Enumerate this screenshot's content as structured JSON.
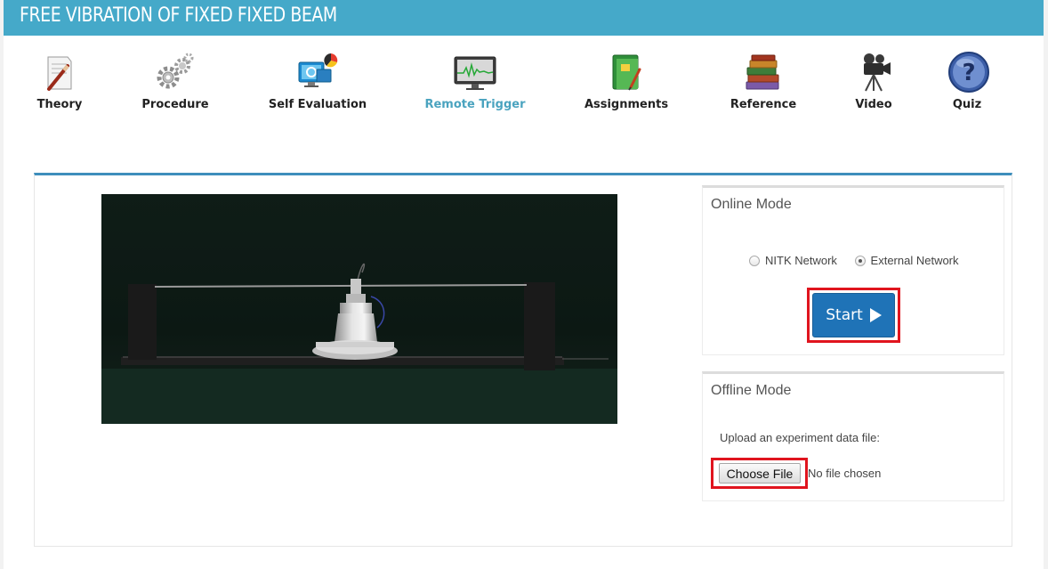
{
  "header": {
    "title": "FREE VIBRATION OF FIXED FIXED BEAM"
  },
  "nav": {
    "items": [
      {
        "label": "Theory",
        "icon": "pencil-document-icon"
      },
      {
        "label": "Procedure",
        "icon": "gears-icon"
      },
      {
        "label": "Self Evaluation",
        "icon": "monitor-pie-chart-icon"
      },
      {
        "label": "Remote Trigger",
        "icon": "signal-monitor-icon",
        "active": true
      },
      {
        "label": "Assignments",
        "icon": "notebook-icon"
      },
      {
        "label": "Reference",
        "icon": "books-icon"
      },
      {
        "label": "Video",
        "icon": "movie-camera-icon"
      },
      {
        "label": "Quiz",
        "icon": "question-mark-icon"
      }
    ]
  },
  "online_mode": {
    "title": "Online Mode",
    "options": [
      {
        "label": "NITK Network",
        "checked": false
      },
      {
        "label": "External Network",
        "checked": true
      }
    ],
    "start_label": "Start"
  },
  "offline_mode": {
    "title": "Offline Mode",
    "upload_label": "Upload an experiment data file:",
    "choose_file_label": "Choose File",
    "file_status": "No file chosen"
  },
  "colors": {
    "header_bg": "#45a9c9",
    "panel_accent": "#3e8ebc",
    "start_button": "#1f73b7",
    "highlight": "#e0141e",
    "active_nav": "#4aa3bf"
  }
}
